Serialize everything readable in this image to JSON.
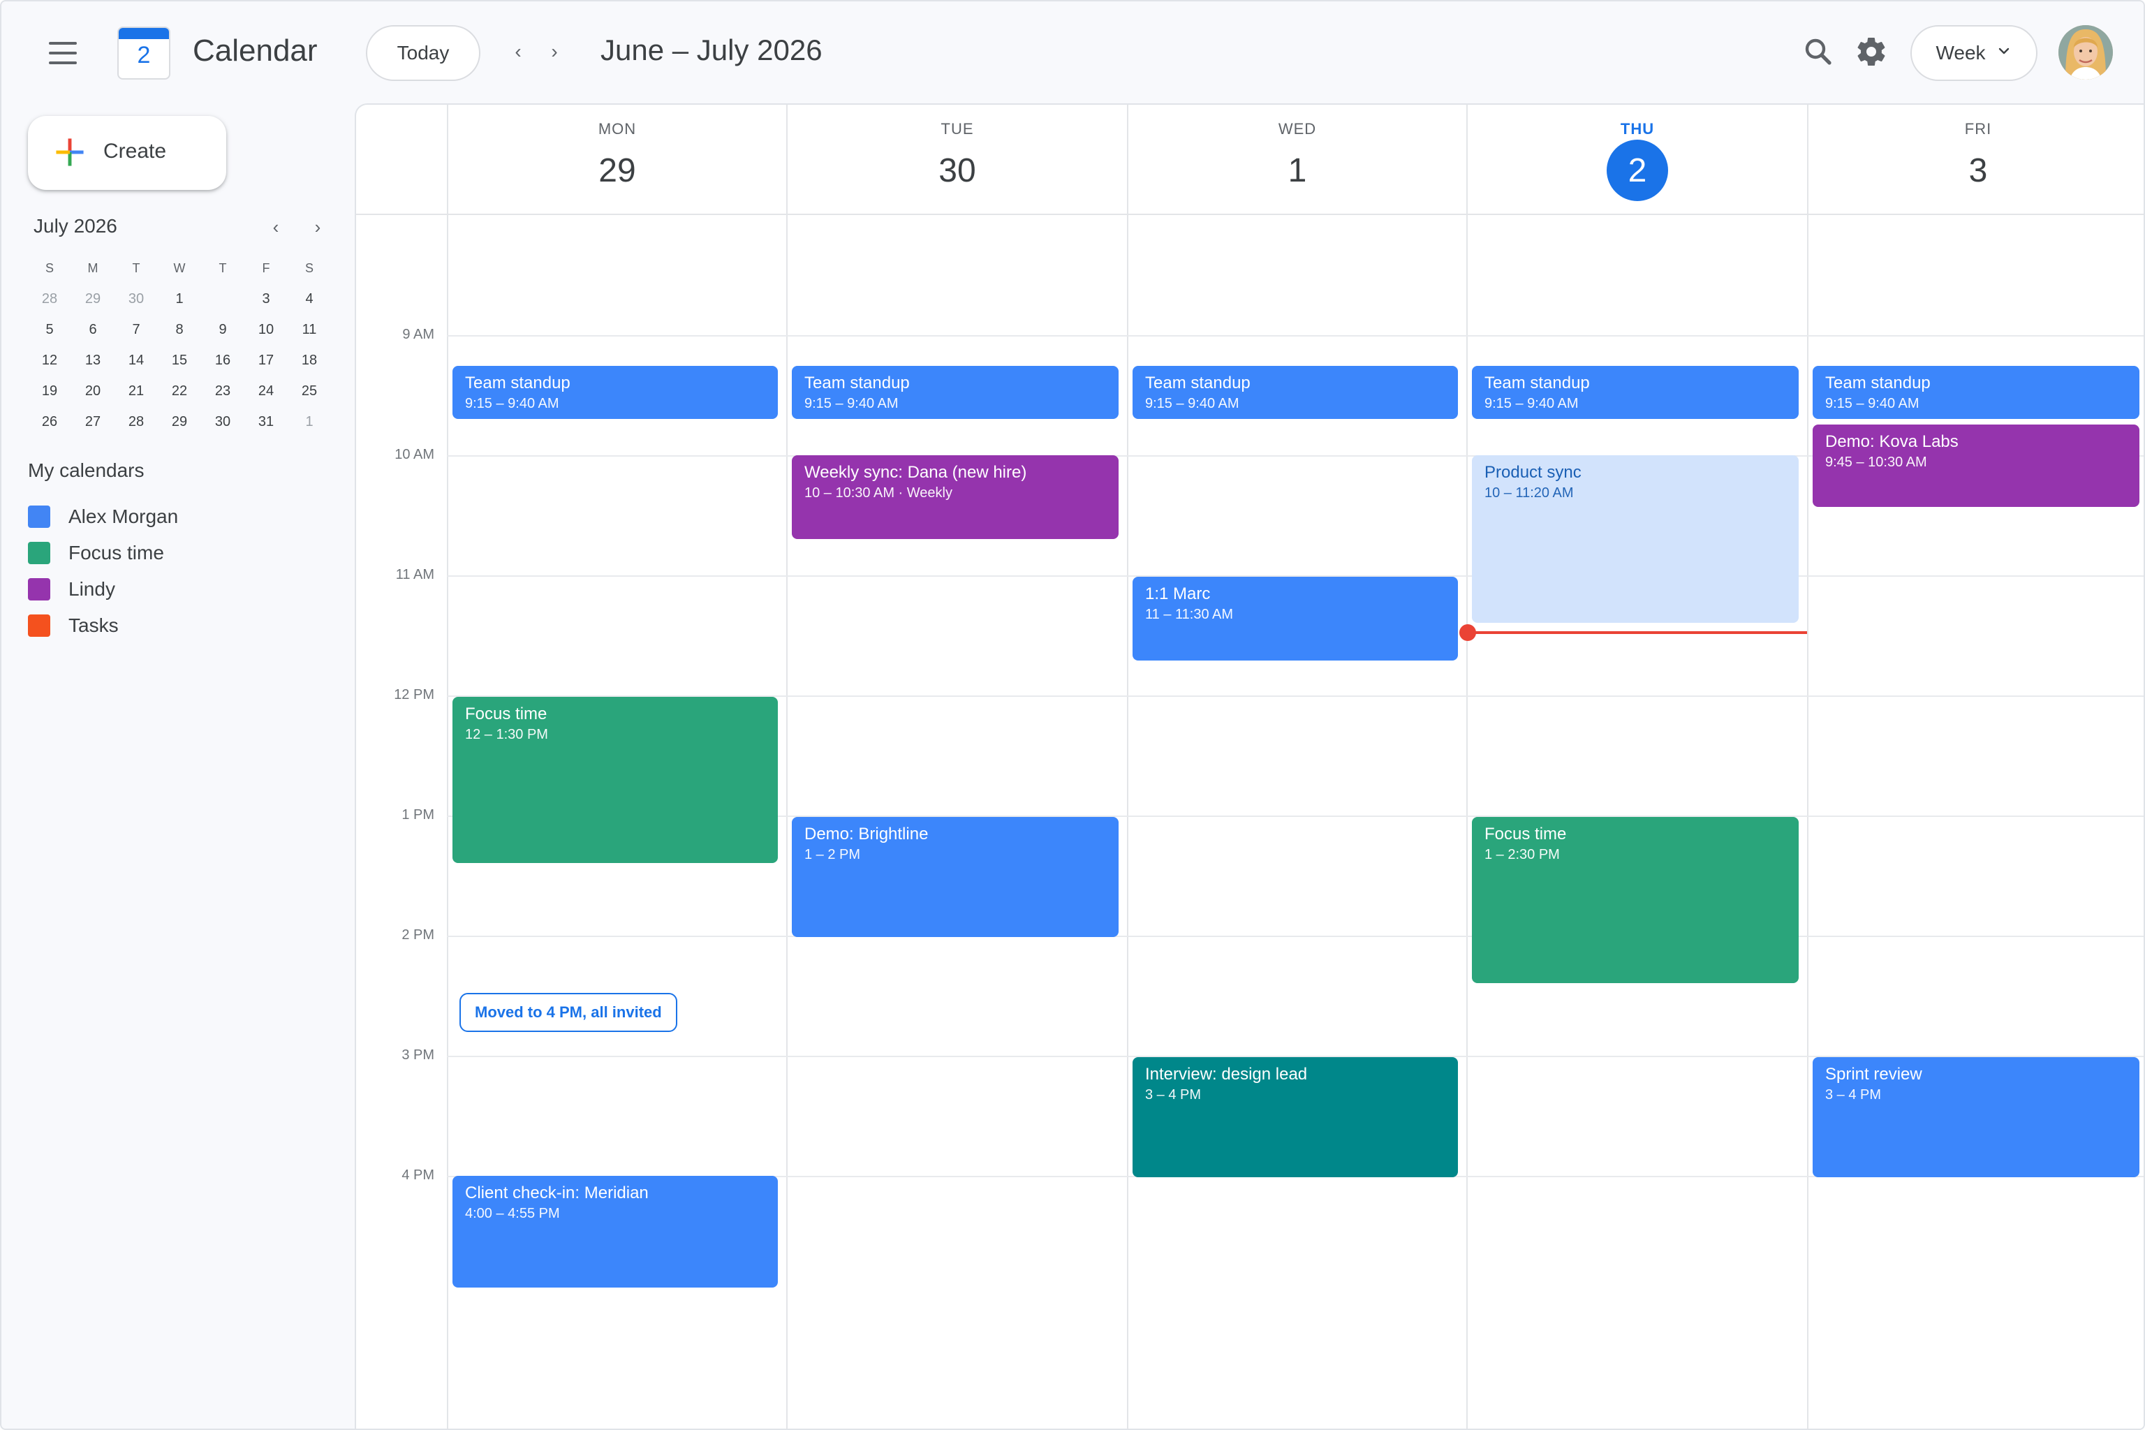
{
  "header": {
    "logo_day": "2",
    "app_title": "Calendar",
    "today_label": "Today",
    "prev_label": "‹",
    "next_label": "›",
    "range_title": "June – July 2026",
    "view_label": "Week"
  },
  "sidebar": {
    "create_label": "Create",
    "mini_calendar": {
      "title": "July 2026",
      "prev_label": "‹",
      "next_label": "›",
      "weekdays": [
        "S",
        "M",
        "T",
        "W",
        "T",
        "F",
        "S"
      ],
      "weeks": [
        [
          "28",
          "29",
          "30",
          "1",
          "",
          "3",
          "4"
        ],
        [
          "5",
          "6",
          "7",
          "8",
          "9",
          "10",
          "11"
        ],
        [
          "12",
          "13",
          "14",
          "15",
          "16",
          "17",
          "18"
        ],
        [
          "19",
          "20",
          "21",
          "22",
          "23",
          "24",
          "25"
        ],
        [
          "26",
          "27",
          "28",
          "29",
          "30",
          "31",
          "1"
        ]
      ]
    },
    "my_calendars_title": "My calendars",
    "calendars": [
      {
        "name": "Alex Morgan",
        "color": "#4285f4"
      },
      {
        "name": "Focus time",
        "color": "#2aa57b"
      },
      {
        "name": "Lindy",
        "color": "#9534ad"
      },
      {
        "name": "Tasks",
        "color": "#f4511e"
      }
    ]
  },
  "week": {
    "days": [
      {
        "dow": "MON",
        "num": "29"
      },
      {
        "dow": "TUE",
        "num": "30"
      },
      {
        "dow": "WED",
        "num": "1"
      },
      {
        "dow": "THU",
        "num": "2",
        "today": true
      },
      {
        "dow": "FRI",
        "num": "3"
      }
    ],
    "hours": [
      "9 AM",
      "10 AM",
      "11 AM",
      "12 PM",
      "1 PM",
      "2 PM",
      "3 PM",
      "4 PM"
    ]
  },
  "events": {
    "mon_standup": {
      "title": "Team standup",
      "time": "9:15 – 9:40 AM"
    },
    "tue_standup": {
      "title": "Team standup",
      "time": "9:15 – 9:40 AM"
    },
    "wed_standup": {
      "title": "Team standup",
      "time": "9:15 – 9:40 AM"
    },
    "thu_standup": {
      "title": "Team standup",
      "time": "9:15 – 9:40 AM"
    },
    "fri_standup": {
      "title": "Team standup",
      "time": "9:15 – 9:40 AM"
    },
    "tue_weekly_sync": {
      "title": "Weekly sync: Dana (new hire)",
      "time": "10 – 10:30 AM · Weekly"
    },
    "thu_product_sync": {
      "title": "Product sync",
      "time": "10 – 11:20 AM"
    },
    "fri_demo_kova": {
      "title": "Demo: Kova Labs",
      "time": "9:45 – 10:30 AM"
    },
    "wed_one_on_one": {
      "title": "1:1 Marc",
      "time": "11 – 11:30 AM"
    },
    "mon_focus": {
      "title": "Focus time",
      "time": "12 – 1:30 PM"
    },
    "tue_demo_brightline": {
      "title": "Demo: Brightline",
      "time": "1 – 2 PM"
    },
    "thu_focus": {
      "title": "Focus time",
      "time": "1 – 2:30 PM"
    },
    "wed_interview": {
      "title": "Interview: design lead",
      "time": "3 – 4 PM"
    },
    "fri_sprint_review": {
      "title": "Sprint review",
      "time": "3 – 4 PM"
    },
    "mon_client_checkin": {
      "title": "Client check-in: Meridian",
      "time": "4:00 – 4:55 PM"
    }
  },
  "chip": {
    "label": "Moved to 4 PM, all invited"
  },
  "colors": {
    "accent": "#1a73e8",
    "event_blue": "#3c86fb",
    "event_purple": "#9534ad",
    "event_green": "#2aa57b",
    "event_teal": "#00878a",
    "now_line": "#ea4335"
  }
}
